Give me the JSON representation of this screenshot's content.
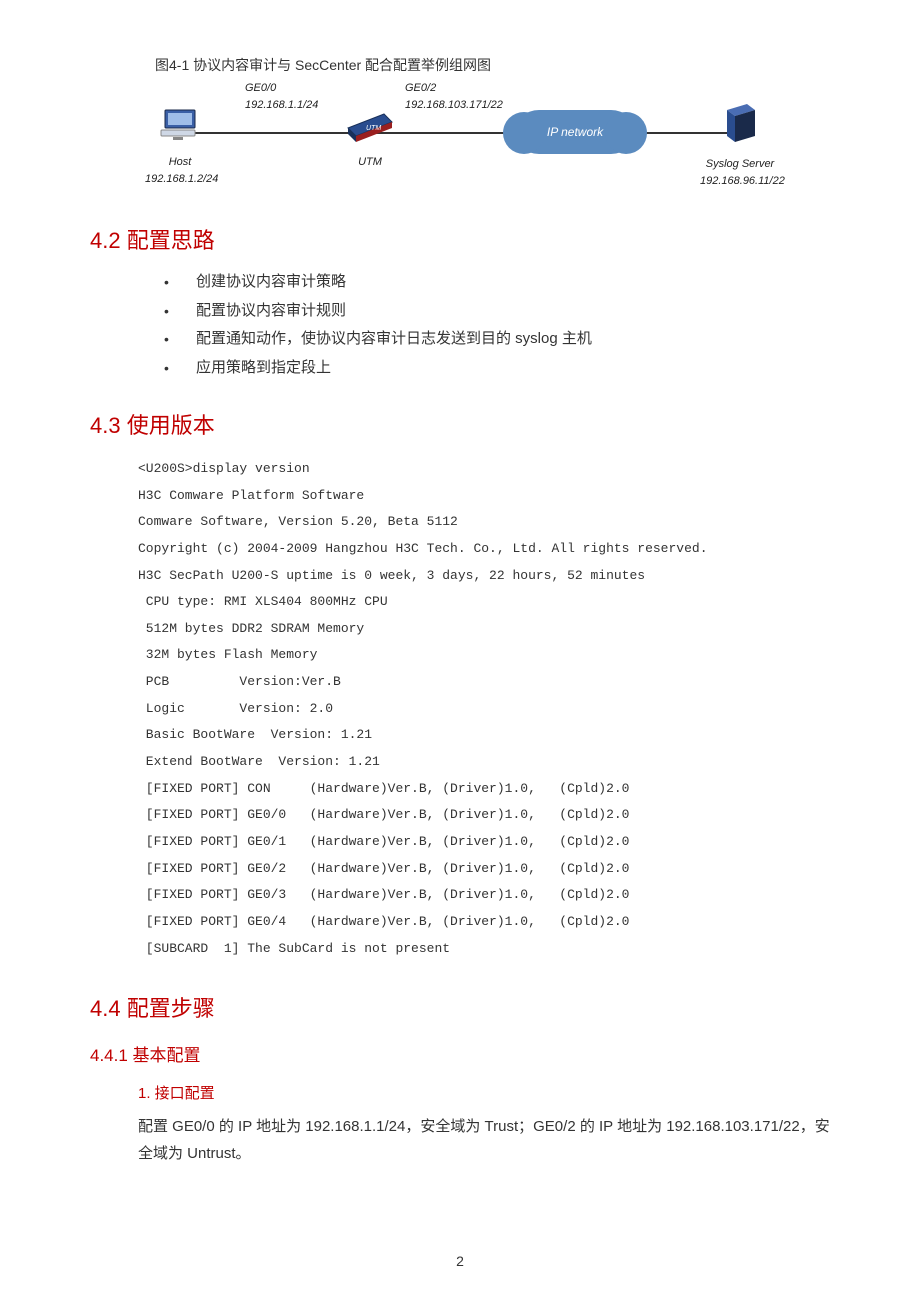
{
  "figure": {
    "caption": "图4-1 协议内容审计与 SecCenter 配合配置举例组网图",
    "host": {
      "label1": "Host",
      "label2": "192.168.1.2/24"
    },
    "ge00": {
      "label1": "GE0/0",
      "label2": "192.168.1.1/24"
    },
    "utm": {
      "label": "UTM"
    },
    "ge02": {
      "label1": "GE0/2",
      "label2": "192.168.103.171/22"
    },
    "cloud": {
      "label": "IP network"
    },
    "server": {
      "label1": "Syslog Server",
      "label2": "192.168.96.11/22"
    }
  },
  "s42": {
    "heading": "4.2  配置思路",
    "items": [
      "创建协议内容审计策略",
      "配置协议内容审计规则",
      "配置通知动作，使协议内容审计日志发送到目的 syslog 主机",
      "应用策略到指定段上"
    ]
  },
  "s43": {
    "heading": "4.3  使用版本",
    "code": "<U200S>display version\nH3C Comware Platform Software\nComware Software, Version 5.20, Beta 5112\nCopyright (c) 2004-2009 Hangzhou H3C Tech. Co., Ltd. All rights reserved.\nH3C SecPath U200-S uptime is 0 week, 3 days, 22 hours, 52 minutes\n CPU type: RMI XLS404 800MHz CPU\n 512M bytes DDR2 SDRAM Memory\n 32M bytes Flash Memory\n PCB         Version:Ver.B\n Logic       Version: 2.0\n Basic BootWare  Version: 1.21\n Extend BootWare  Version: 1.21\n [FIXED PORT] CON     (Hardware)Ver.B, (Driver)1.0,   (Cpld)2.0\n [FIXED PORT] GE0/0   (Hardware)Ver.B, (Driver)1.0,   (Cpld)2.0\n [FIXED PORT] GE0/1   (Hardware)Ver.B, (Driver)1.0,   (Cpld)2.0\n [FIXED PORT] GE0/2   (Hardware)Ver.B, (Driver)1.0,   (Cpld)2.0\n [FIXED PORT] GE0/3   (Hardware)Ver.B, (Driver)1.0,   (Cpld)2.0\n [FIXED PORT] GE0/4   (Hardware)Ver.B, (Driver)1.0,   (Cpld)2.0\n [SUBCARD  1] The SubCard is not present"
  },
  "s44": {
    "heading": "4.4  配置步骤",
    "s441": {
      "heading": "4.4.1  基本配置",
      "h4": "1. 接口配置",
      "para": "配置 GE0/0 的 IP 地址为 192.168.1.1/24，安全域为 Trust；GE0/2 的 IP 地址为 192.168.103.171/22，安全域为 Untrust。"
    }
  },
  "page_number": "2"
}
